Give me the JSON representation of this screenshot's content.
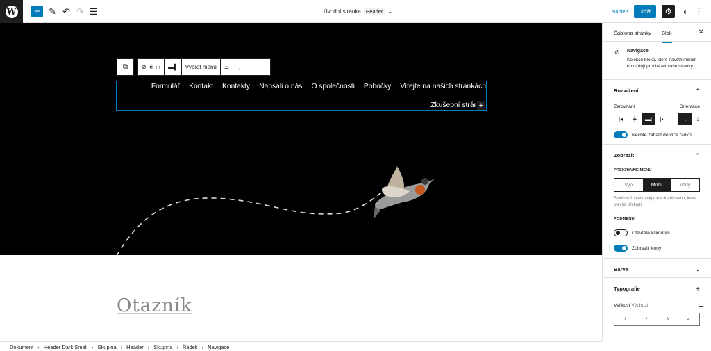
{
  "topbar": {
    "doc_title": "Úvodní stránka",
    "doc_tag": "Header",
    "preview": "Náhled",
    "save": "Uložit"
  },
  "toolbar": {
    "select_menu": "Vybrat menu"
  },
  "navigation": {
    "items": [
      "Formulář",
      "Kontakt",
      "Kontakty",
      "Napsali o nás",
      "O společnosti",
      "Pobočky",
      "Vítejte na našich stránkách"
    ],
    "second_row": "Zkušební strár"
  },
  "canvas": {
    "heading": "Otazník"
  },
  "sidebar": {
    "tab_template": "Šablona stránky",
    "tab_block": "Blok",
    "block_title": "Navigace",
    "block_desc": "Kolekce bloků, které návštěvníkům umožňují procházet vaše stránky.",
    "layout": {
      "title": "Rozvržení",
      "align_label": "Zarovnání",
      "orient_label": "Orientace",
      "wrap_label": "Nechte zabalit do více řádků"
    },
    "display": {
      "title": "Zobrazit",
      "overlay_label": "PŘEKRYVNÉ MENU",
      "options": [
        "Vyp",
        "Mobil",
        "Vždy"
      ],
      "selected": "Mobil",
      "overlay_desc": "Sbalí možnosti navigace v ikoně menu, která otevírá překrytí.",
      "submenu_label": "PODMENU",
      "open_click": "Otevřete kliknutím",
      "show_icon": "Zobrazit ikony"
    },
    "color": {
      "title": "Barva"
    },
    "typography": {
      "title": "Typografie",
      "size_label": "Velikost",
      "size_value": "Výchozí",
      "sizes": [
        "1",
        "2",
        "3",
        "4"
      ]
    }
  },
  "breadcrumb": [
    "Dokument",
    "Header Dark Small",
    "Skupina",
    "Header",
    "Skupina",
    "Řádek",
    "Navigace"
  ],
  "colors": {
    "accent": "#007cba",
    "dark": "#000000"
  }
}
